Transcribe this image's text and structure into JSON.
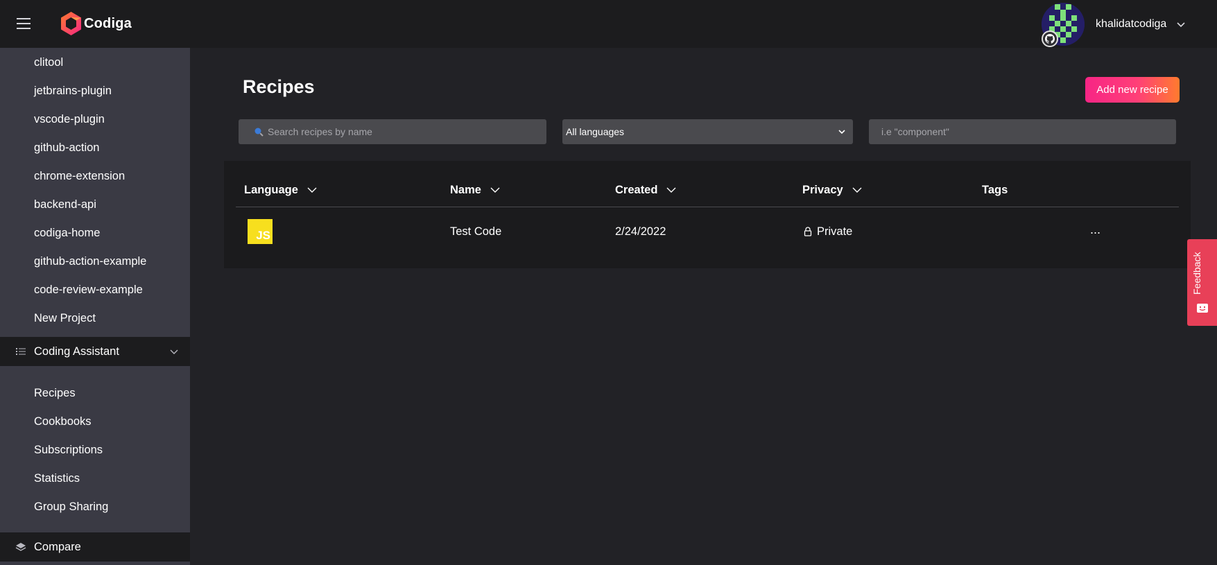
{
  "app": {
    "name": "Codiga"
  },
  "user": {
    "name": "khalidatcodiga"
  },
  "sidebar": {
    "projects": [
      "clitool",
      "jetbrains-plugin",
      "vscode-plugin",
      "github-action",
      "chrome-extension",
      "backend-api",
      "codiga-home",
      "github-action-example",
      "code-review-example",
      "New Project"
    ],
    "coding_assistant": {
      "label": "Coding Assistant",
      "items": [
        "Recipes",
        "Cookbooks",
        "Subscriptions",
        "Statistics",
        "Group Sharing"
      ]
    },
    "compare": {
      "label": "Compare"
    }
  },
  "page": {
    "title": "Recipes",
    "add_button": "Add new recipe"
  },
  "filters": {
    "search_placeholder": "Search recipes by name",
    "language_selected": "All languages",
    "tag_placeholder": "i.e \"component\""
  },
  "table": {
    "columns": [
      "Language",
      "Name",
      "Created",
      "Privacy",
      "Tags"
    ],
    "rows": [
      {
        "language": "JS",
        "name": "Test Code",
        "created": "2/24/2022",
        "privacy": "Private",
        "more": "..."
      }
    ]
  },
  "feedback": {
    "label": "Feedback"
  },
  "colors": {
    "accent_start": "#f72585",
    "accent_end": "#ff7b2e",
    "js_yellow": "#f7df1e",
    "feedback_red": "#e84058"
  },
  "icons": {
    "menu": "hamburger-icon",
    "logo": "codiga-logo-icon",
    "github": "github-icon",
    "search": "search-icon",
    "lock": "lock-icon",
    "list": "list-icon",
    "layers": "layers-icon",
    "chevron": "chevron-down-icon"
  }
}
